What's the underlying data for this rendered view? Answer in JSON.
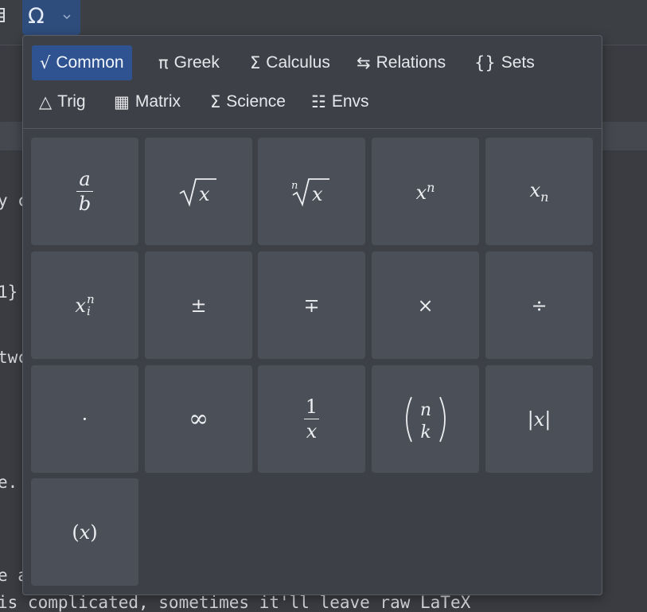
{
  "toolbar": {
    "insert_symbol_glyph": "Ω"
  },
  "editor": {
    "line_1": "y c",
    "line_2": "1}",
    "line_3": "twc",
    "line_4": "e.",
    "line_5": "e a",
    "line_6": "is complicated, sometimes it'll leave raw LaTeX"
  },
  "tabs": [
    {
      "label": "Common",
      "icon": "√",
      "icon_name": "sqrt-icon",
      "active": true
    },
    {
      "label": "Greek",
      "icon": "π",
      "icon_name": "pi-icon",
      "active": false
    },
    {
      "label": "Calculus",
      "icon": "Σ",
      "icon_name": "sigma-icon",
      "active": false
    },
    {
      "label": "Relations",
      "icon": "⇆",
      "icon_name": "relations-arrows-icon",
      "active": false
    },
    {
      "label": "Sets",
      "icon": "{}",
      "icon_name": "braces-icon",
      "active": false
    },
    {
      "label": "Trig",
      "icon": "△",
      "icon_name": "triangle-icon",
      "active": false
    },
    {
      "label": "Matrix",
      "icon": "▦",
      "icon_name": "grid-icon",
      "active": false
    },
    {
      "label": "Science",
      "icon": "Σ",
      "icon_name": "sigma-icon",
      "active": false
    },
    {
      "label": "Envs",
      "icon": "☷",
      "icon_name": "list-icon",
      "active": false
    }
  ],
  "symbols": [
    "a/b",
    "√x",
    "ⁿ√x",
    "xⁿ",
    "xₙ",
    "xᵢⁿ",
    "±",
    "∓",
    "×",
    "÷",
    "·",
    "∞",
    "1/x",
    "(n k)",
    "|x|",
    "(x)"
  ],
  "colors": {
    "accent": "#2f5391",
    "tile": "#4b4f57",
    "popup_bg": "#3d4046",
    "editor_bg": "#3a3c41"
  }
}
